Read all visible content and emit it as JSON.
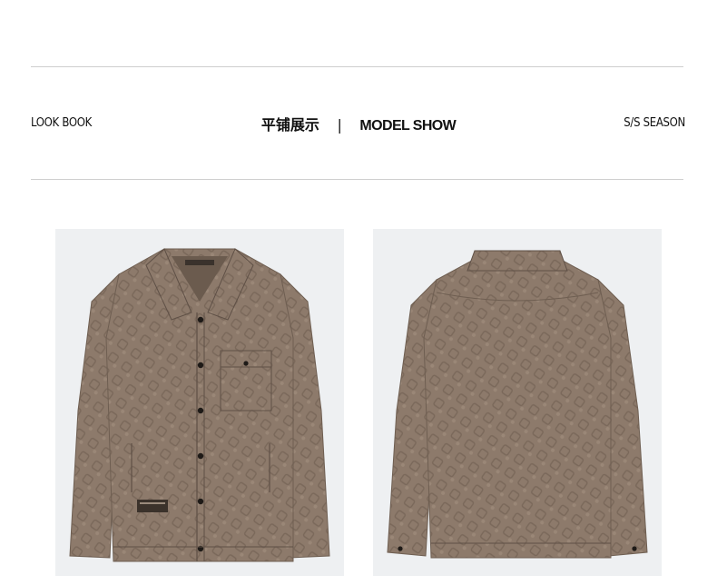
{
  "header": {
    "left_label": "LOOK BOOK",
    "title_cn": "平铺展示",
    "separator": "|",
    "title_en": "MODEL SHOW",
    "right_label": "S/S SEASON"
  },
  "colors": {
    "jacket": "#8d7a6b",
    "jacket_dark": "#6e5e51",
    "photo_bg": "#eef0f2",
    "rule": "#cfcfcf"
  },
  "photos": [
    {
      "view": "front",
      "icon": "jacket-front-image"
    },
    {
      "view": "back",
      "icon": "jacket-back-image"
    }
  ]
}
